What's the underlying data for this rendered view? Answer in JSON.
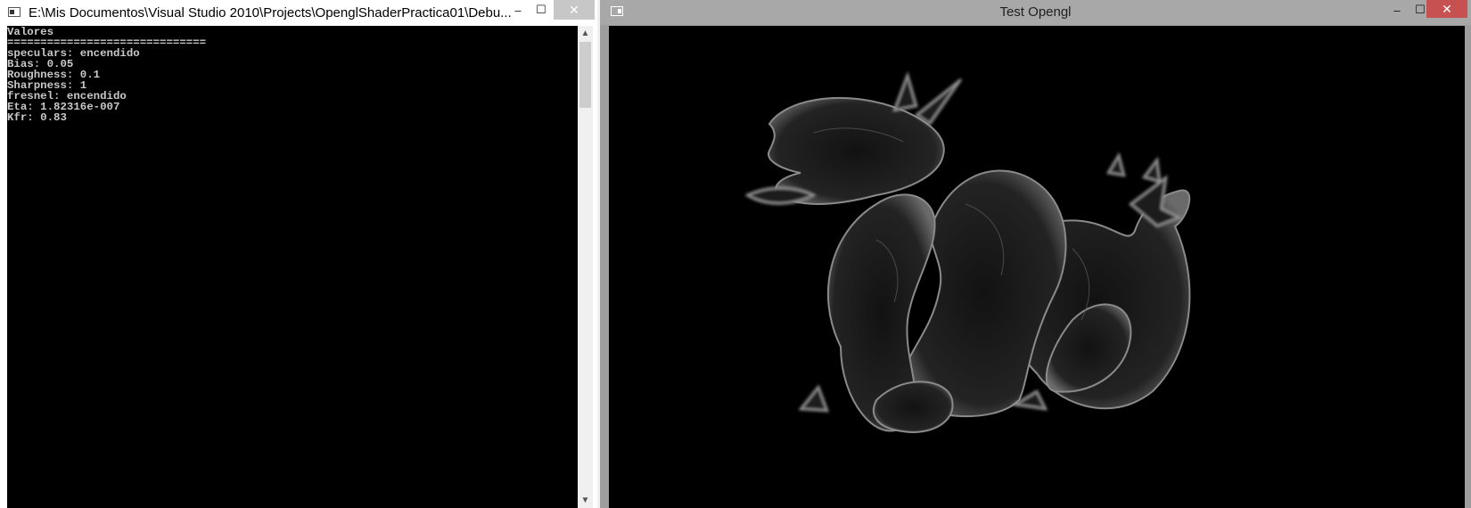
{
  "console": {
    "title": "E:\\Mis Documentos\\Visual Studio 2010\\Projects\\OpenglShaderPractica01\\Debu...",
    "lines": [
      "Valores",
      "==============================",
      "speculars: encendido",
      "Bias: 0.05",
      "Roughness: 0.1",
      "Sharpness: 1",
      "fresnel: encendido",
      "Eta: 1.82316e-007",
      "Kfr: 0.83"
    ],
    "controls": {
      "minimize": "–",
      "maximize": "☐",
      "close": "✕"
    },
    "scroll_up": "▲",
    "scroll_down": "▼"
  },
  "gl": {
    "title": "Test Opengl",
    "controls": {
      "minimize": "–",
      "maximize": "☐",
      "close": "✕"
    },
    "scene_object": "dragon"
  },
  "colors": {
    "console_bg": "#000000",
    "console_text": "#c8c8c8",
    "gl_titlebar": "#a8a8a8",
    "close_active": "#c75050"
  }
}
